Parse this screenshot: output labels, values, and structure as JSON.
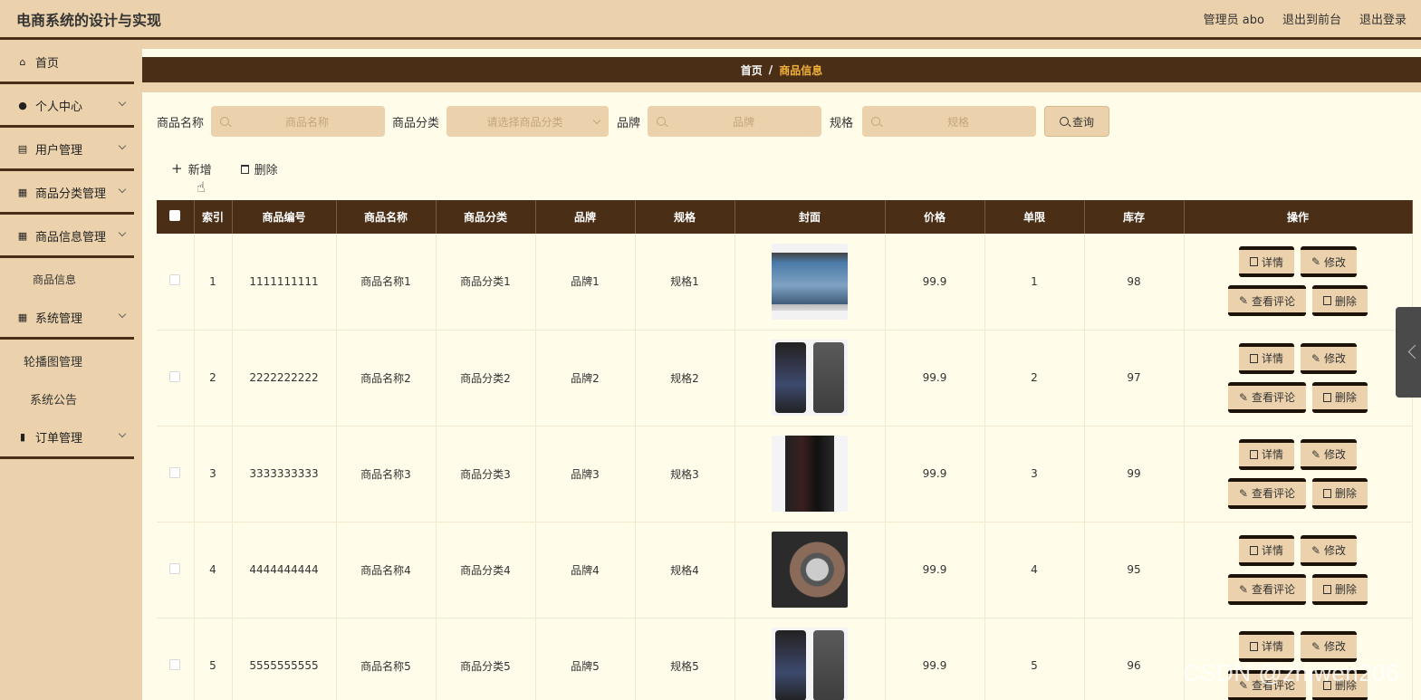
{
  "header": {
    "title": "电商系统的设计与实现",
    "user": "管理员 abo",
    "front_link": "退出到前台",
    "logout_link": "退出登录"
  },
  "sidebar": {
    "items": [
      {
        "label": "首页",
        "icon": "home-icon",
        "has_chevron": false
      },
      {
        "label": "个人中心",
        "icon": "user-icon",
        "has_chevron": true
      },
      {
        "label": "用户管理",
        "icon": "clipboard-icon",
        "has_chevron": true
      },
      {
        "label": "商品分类管理",
        "icon": "grid-icon",
        "has_chevron": true
      },
      {
        "label": "商品信息管理",
        "icon": "grid-icon",
        "has_chevron": true
      },
      {
        "label": "商品信息",
        "sub": true
      },
      {
        "label": "系统管理",
        "icon": "grid-icon",
        "has_chevron": true
      },
      {
        "label": "轮播图管理",
        "sub": true
      },
      {
        "label": "系统公告",
        "sub": true
      },
      {
        "label": "订单管理",
        "icon": "bar-chart-icon",
        "has_chevron": true
      }
    ]
  },
  "breadcrumb": {
    "home": "首页",
    "sep": "/",
    "current": "商品信息"
  },
  "search": {
    "name_label": "商品名称",
    "name_placeholder": "商品名称",
    "category_label": "商品分类",
    "category_placeholder": "请选择商品分类",
    "brand_label": "品牌",
    "brand_placeholder": "品牌",
    "spec_label": "规格",
    "spec_placeholder": "规格",
    "query_button": "查询"
  },
  "actions": {
    "add": "新增",
    "delete": "删除"
  },
  "table": {
    "headers": [
      "",
      "索引",
      "商品编号",
      "商品名称",
      "商品分类",
      "品牌",
      "规格",
      "封面",
      "价格",
      "单限",
      "库存",
      "操作"
    ],
    "rows": [
      {
        "index": "1",
        "code": "1111111111",
        "name": "商品名称1",
        "category": "商品分类1",
        "brand": "品牌1",
        "spec": "规格1",
        "cover": "laptop",
        "price": "99.9",
        "limit": "1",
        "stock": "98"
      },
      {
        "index": "2",
        "code": "2222222222",
        "name": "商品名称2",
        "category": "商品分类2",
        "brand": "品牌2",
        "spec": "规格2",
        "cover": "phone",
        "price": "99.9",
        "limit": "2",
        "stock": "97"
      },
      {
        "index": "3",
        "code": "3333333333",
        "name": "商品名称3",
        "category": "商品分类3",
        "brand": "品牌3",
        "spec": "规格3",
        "cover": "pc-case",
        "price": "99.9",
        "limit": "3",
        "stock": "99"
      },
      {
        "index": "4",
        "code": "4444444444",
        "name": "商品名称4",
        "category": "商品分类4",
        "brand": "品牌4",
        "spec": "规格4",
        "cover": "watch",
        "price": "99.9",
        "limit": "4",
        "stock": "95"
      },
      {
        "index": "5",
        "code": "5555555555",
        "name": "商品名称5",
        "category": "商品分类5",
        "brand": "品牌5",
        "spec": "规格5",
        "cover": "phone",
        "price": "99.9",
        "limit": "5",
        "stock": "96"
      }
    ],
    "op_labels": {
      "detail": "详情",
      "edit": "修改",
      "comments": "查看评论",
      "delete": "删除"
    }
  },
  "watermark": "CSDN @zhiwen206",
  "colors": {
    "primary": "#4a2e15",
    "accent": "#ecd2ac",
    "content_bg": "#fffcea",
    "breadcrumb_current": "#f2b13a"
  }
}
